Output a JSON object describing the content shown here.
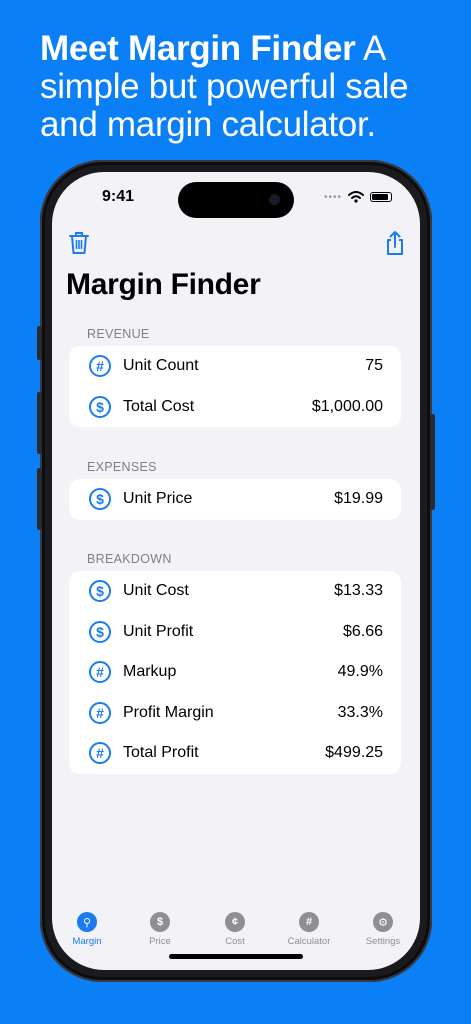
{
  "headline": {
    "bold": "Meet Margin Finder",
    "rest": " A simple but powerful sale and margin calculator."
  },
  "status": {
    "time": "9:41"
  },
  "nav": {
    "trash_icon": "trash-icon",
    "share_icon": "share-icon"
  },
  "page_title": "Margin Finder",
  "sections": {
    "revenue": {
      "label": "REVENUE",
      "rows": [
        {
          "icon": "#",
          "label": "Unit Count",
          "value": "75"
        },
        {
          "icon": "$",
          "label": "Total Cost",
          "value": "$1,000.00"
        }
      ]
    },
    "expenses": {
      "label": "EXPENSES",
      "rows": [
        {
          "icon": "$",
          "label": "Unit Price",
          "value": "$19.99"
        }
      ]
    },
    "breakdown": {
      "label": "BREAKDOWN",
      "rows": [
        {
          "icon": "$",
          "label": "Unit Cost",
          "value": "$13.33"
        },
        {
          "icon": "$",
          "label": "Unit Profit",
          "value": "$6.66"
        },
        {
          "icon": "#",
          "label": "Markup",
          "value": "49.9%"
        },
        {
          "icon": "#",
          "label": "Profit Margin",
          "value": "33.3%"
        },
        {
          "icon": "#",
          "label": "Total Profit",
          "value": "$499.25"
        }
      ]
    }
  },
  "tabs": [
    {
      "label": "Margin",
      "glyph": "⚲",
      "active": true
    },
    {
      "label": "Price",
      "glyph": "$",
      "active": false
    },
    {
      "label": "Cost",
      "glyph": "¢",
      "active": false
    },
    {
      "label": "Calculator",
      "glyph": "#",
      "active": false
    },
    {
      "label": "Settings",
      "glyph": "⚙",
      "active": false
    }
  ],
  "colors": {
    "background": "#0b7ff5",
    "accent": "#1a7cf0",
    "screen_bg": "#f2f2f7"
  }
}
